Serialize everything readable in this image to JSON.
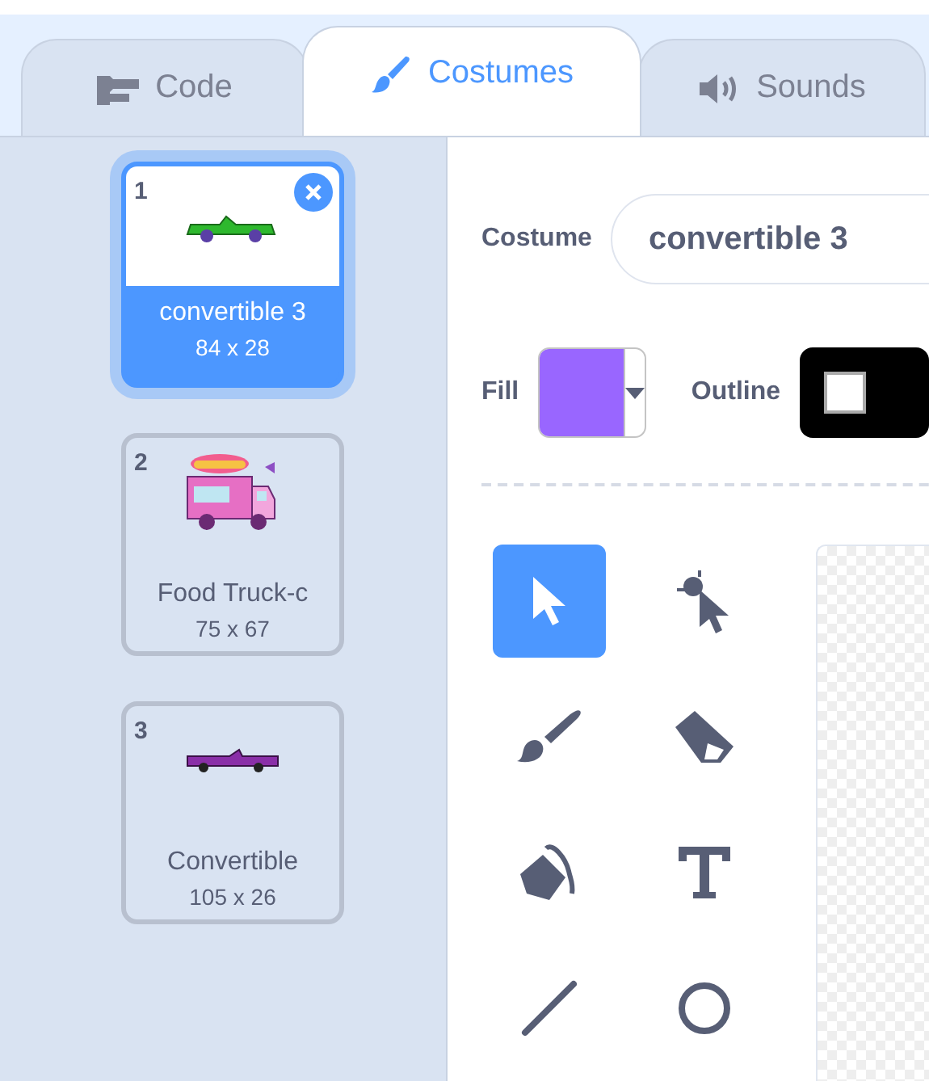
{
  "tabs": [
    {
      "kind": "code",
      "label": "Code",
      "selected": false
    },
    {
      "kind": "costumes",
      "label": "Costumes",
      "selected": true
    },
    {
      "kind": "sounds",
      "label": "Sounds",
      "selected": false
    }
  ],
  "costumes": [
    {
      "number": "1",
      "name": "convertible 3",
      "size": "84 x 28",
      "kind": "sportscar",
      "selected": true
    },
    {
      "number": "2",
      "name": "Food Truck-c",
      "size": "75 x 67",
      "kind": "truck",
      "selected": false
    },
    {
      "number": "3",
      "name": "Convertible",
      "size": "105 x 26",
      "kind": "limousine",
      "selected": false
    }
  ],
  "costume_field": {
    "label": "Costume",
    "value": "convertible 3"
  },
  "fill": {
    "label": "Fill",
    "color": "#9966ff"
  },
  "outline": {
    "label": "Outline",
    "color": "#000000"
  },
  "tools": [
    {
      "kind": "select",
      "selected": true
    },
    {
      "kind": "reshape",
      "selected": false
    },
    {
      "kind": "brush",
      "selected": false
    },
    {
      "kind": "eraser",
      "selected": false
    },
    {
      "kind": "fill",
      "selected": false
    },
    {
      "kind": "text",
      "selected": false
    },
    {
      "kind": "line",
      "selected": false
    },
    {
      "kind": "circle",
      "selected": false
    }
  ]
}
